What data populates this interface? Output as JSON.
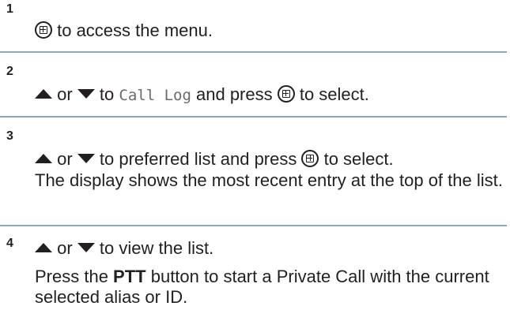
{
  "steps": [
    {
      "number": "1",
      "icon_start": "menu-ok-icon",
      "text": " to access the menu."
    },
    {
      "number": "2",
      "connector_or": " or ",
      "text_to": " to ",
      "menu_item": "Call Log",
      "text_and_press": " and press ",
      "text_to_select": " to select."
    },
    {
      "number": "3",
      "connector_or": " or ",
      "text_to_preferred": " to preferred list and press ",
      "text_to_select": " to select.",
      "description": "The display shows the most recent entry at the top of the list."
    },
    {
      "number": "4",
      "connector_or": " or ",
      "text_view": " to view the list.",
      "press_prefix": "Press the ",
      "button_name": "PTT",
      "press_suffix": " button to start a Private Call with the current selected alias or ID."
    }
  ],
  "colors": {
    "text": "#231f20",
    "divider": "#8fa6c1",
    "menu_item_text": "#6b6b6b"
  }
}
